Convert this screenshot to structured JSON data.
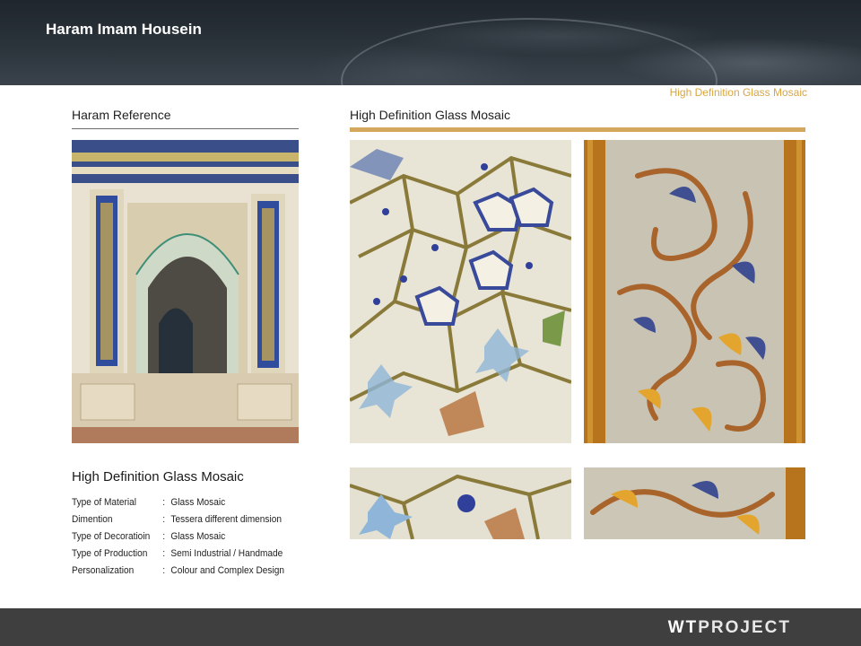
{
  "header": {
    "title": "Haram Imam Housein"
  },
  "corner_label": "High Definition Glass Mosaic",
  "left_section": {
    "title": "Haram Reference"
  },
  "right_section": {
    "title": "High Definition Glass Mosaic"
  },
  "info": {
    "title": "High Definition Glass Mosaic",
    "rows": [
      {
        "key": "Type of Material",
        "sep": ":",
        "value": "Glass Mosaic"
      },
      {
        "key": "Dimention",
        "sep": ":",
        "value": "Tessera different dimension"
      },
      {
        "key": "Type of Decoratioin",
        "sep": ":",
        "value": "Glass Mosaic"
      },
      {
        "key": "Type of Production",
        "sep": ":",
        "value": "Semi Industrial / Handmade"
      },
      {
        "key": "Personalization",
        "sep": ":",
        "value": "Colour and Complex Design"
      }
    ]
  },
  "footer": {
    "logo_wt": "WT",
    "logo_project": "PROJECT"
  },
  "colors": {
    "accent_gold": "#d4a85c",
    "header_dark": "#2b333b",
    "footer_dark": "#3f3f3f"
  }
}
